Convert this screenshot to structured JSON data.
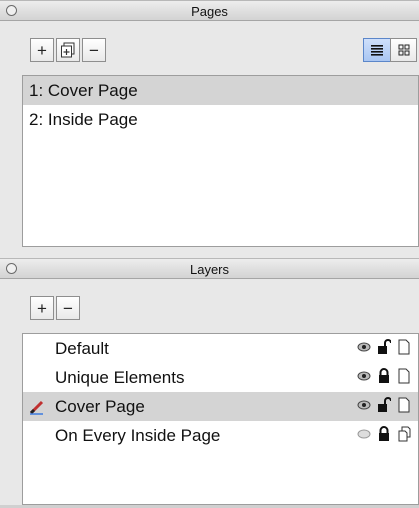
{
  "pages_panel": {
    "title": "Pages",
    "toolbar": {
      "add_label": "+",
      "remove_label": "−"
    },
    "items": [
      {
        "label": "1: Cover Page",
        "selected": true
      },
      {
        "label": "2: Inside Page",
        "selected": false
      }
    ]
  },
  "layers_panel": {
    "title": "Layers",
    "toolbar": {
      "add_label": "+",
      "remove_label": "−"
    },
    "items": [
      {
        "label": "Default",
        "selected": false,
        "icons": [
          "eye-icon",
          "unlock-icon",
          "page-icon"
        ]
      },
      {
        "label": "Unique Elements",
        "selected": false,
        "icons": [
          "eye-icon",
          "lock-icon",
          "page-icon"
        ]
      },
      {
        "label": "Cover Page",
        "selected": true,
        "icons": [
          "eye-icon",
          "unlock-icon",
          "page-icon"
        ]
      },
      {
        "label": "On Every Inside Page",
        "selected": false,
        "icons": [
          "eye-closed-icon",
          "lock-icon",
          "pages-icon"
        ]
      }
    ]
  },
  "colors": {
    "selection": "#d4d4d4",
    "accent": "#3d7be0"
  }
}
